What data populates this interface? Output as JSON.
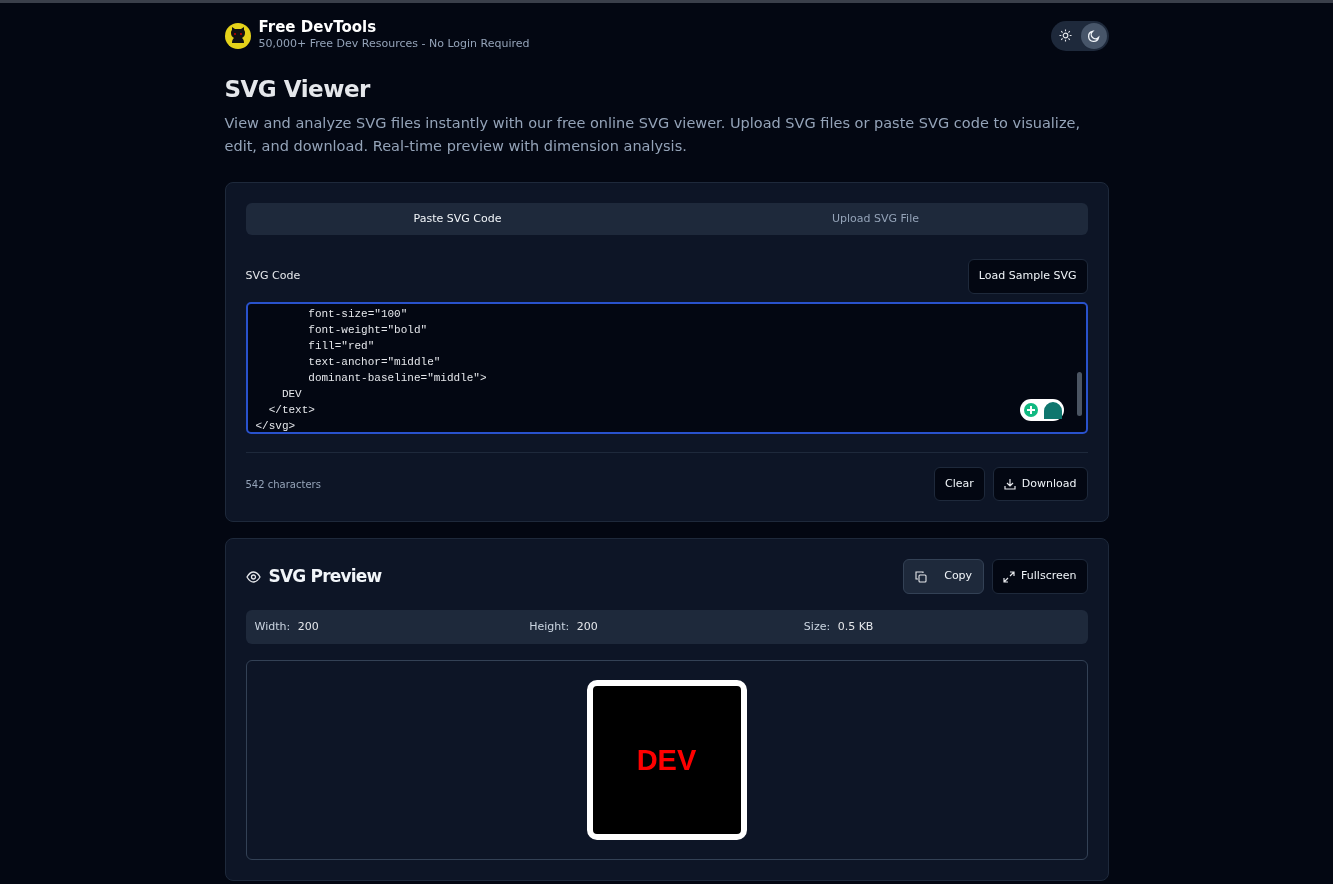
{
  "header": {
    "brand": "Free DevTools",
    "tagline": "50,000+ Free Dev Resources - No Login Required",
    "theme_options": [
      {
        "kind": "light",
        "selected": false
      },
      {
        "kind": "dark",
        "selected": true
      }
    ]
  },
  "page": {
    "title": "SVG Viewer",
    "description": "View and analyze SVG files instantly with our free online SVG viewer. Upload SVG files or paste SVG code to visualize, edit, and download. Real-time preview with dimension analysis."
  },
  "input_panel": {
    "tabs": [
      {
        "label": "Paste SVG Code",
        "selected": true
      },
      {
        "label": "Upload SVG File",
        "selected": false
      }
    ],
    "code_label": "SVG Code",
    "sample_button": "Load Sample SVG",
    "code_lines": [
      "        font-size=\"100\"",
      "        font-weight=\"bold\"",
      "        fill=\"red\"",
      "        text-anchor=\"middle\"",
      "        dominant-baseline=\"middle\">",
      "    DEV",
      "  </text>",
      "</svg>"
    ],
    "char_count": "542 characters",
    "buttons": [
      {
        "kind": "clear",
        "label": "Clear"
      },
      {
        "kind": "download",
        "label": "Download"
      }
    ]
  },
  "preview_panel": {
    "title": "SVG Preview",
    "buttons": [
      {
        "kind": "copy",
        "label": "Copy"
      },
      {
        "kind": "fullscreen",
        "label": "Fullscreen"
      }
    ],
    "stats": [
      {
        "label": "Width:",
        "value": "200"
      },
      {
        "label": "Height:",
        "value": "200"
      },
      {
        "label": "Size:",
        "value": "0.5 KB"
      }
    ],
    "preview": {
      "text": "DEV",
      "color": "#ff0000"
    }
  }
}
